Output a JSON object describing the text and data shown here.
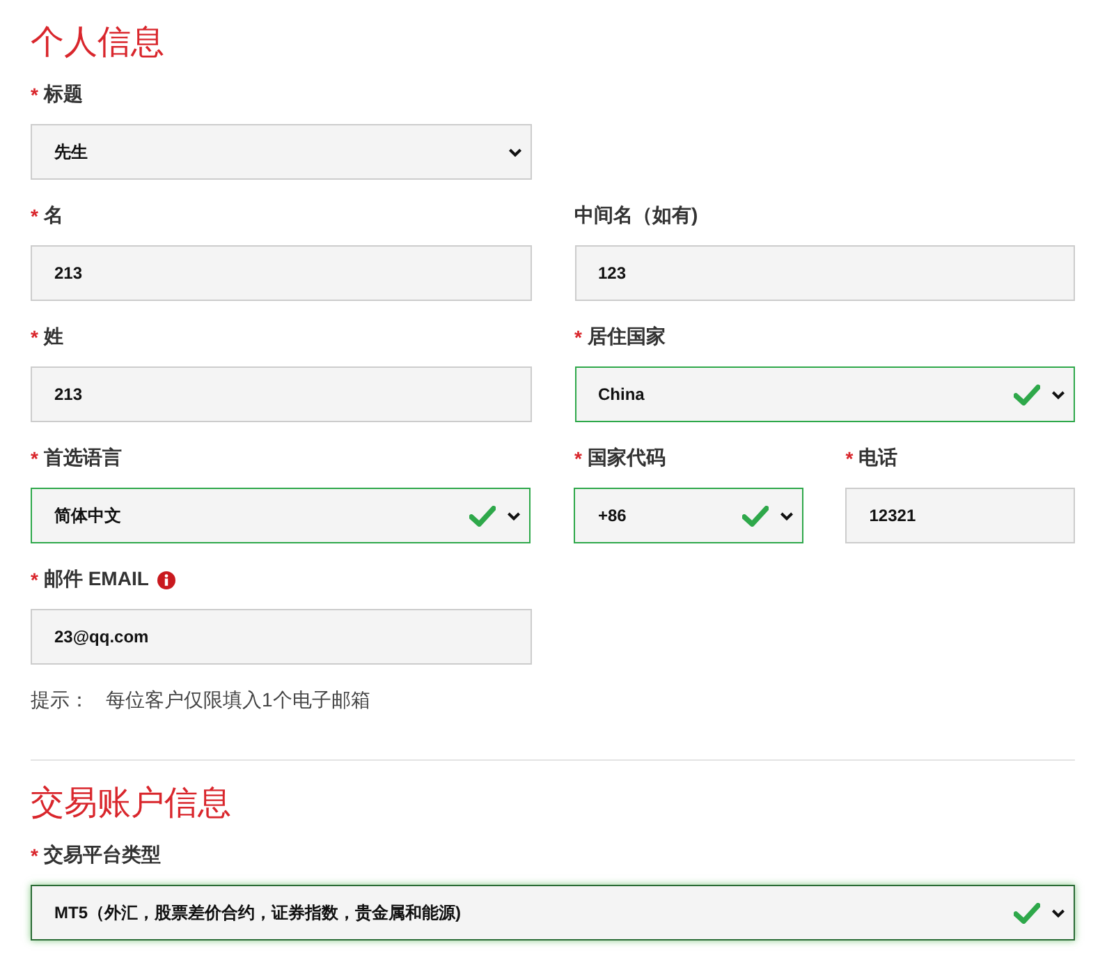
{
  "sections": [
    {
      "title": "个人信息",
      "rows": [
        [
          {
            "mark": "*",
            "label": "标题",
            "kind": "select",
            "value": "先生",
            "valid": false
          }
        ],
        [
          {
            "mark": "*",
            "label": "名",
            "kind": "text",
            "value": "213",
            "valid": false
          },
          {
            "label": "中间名（如有)",
            "kind": "text",
            "value": "123",
            "valid": false
          }
        ],
        [
          {
            "mark": "*",
            "label": "姓",
            "kind": "text",
            "value": "213",
            "valid": false
          },
          {
            "mark": "*",
            "label": "居住国家",
            "kind": "select",
            "value": "China",
            "valid": true
          }
        ],
        [
          {
            "mark": "*",
            "label": "首选语言",
            "kind": "select",
            "value": "简体中文",
            "valid": true
          },
          {
            "mark": "*",
            "label": "国家代码",
            "kind": "select",
            "value": "+86",
            "valid": true,
            "narrow": true
          },
          {
            "mark": "*",
            "label": "电话",
            "kind": "text",
            "value": "12321",
            "valid": false,
            "narrow": true
          }
        ],
        [
          {
            "mark": "*",
            "label": "邮件 EMAIL",
            "kind": "text",
            "value": "23@qq.com",
            "valid": false,
            "info": true
          }
        ]
      ],
      "hint": {
        "label": "提示：",
        "text": "每位客户仅限填入1个电子邮箱"
      }
    },
    {
      "title": "交易账户信息",
      "rows": [
        [
          {
            "mark": "*",
            "label": "交易平台类型",
            "kind": "select",
            "value": "MT5（外汇，股票差价合约，证券指数，贵金属和能源)",
            "valid": true,
            "wide": true,
            "focused": true
          }
        ]
      ]
    }
  ]
}
